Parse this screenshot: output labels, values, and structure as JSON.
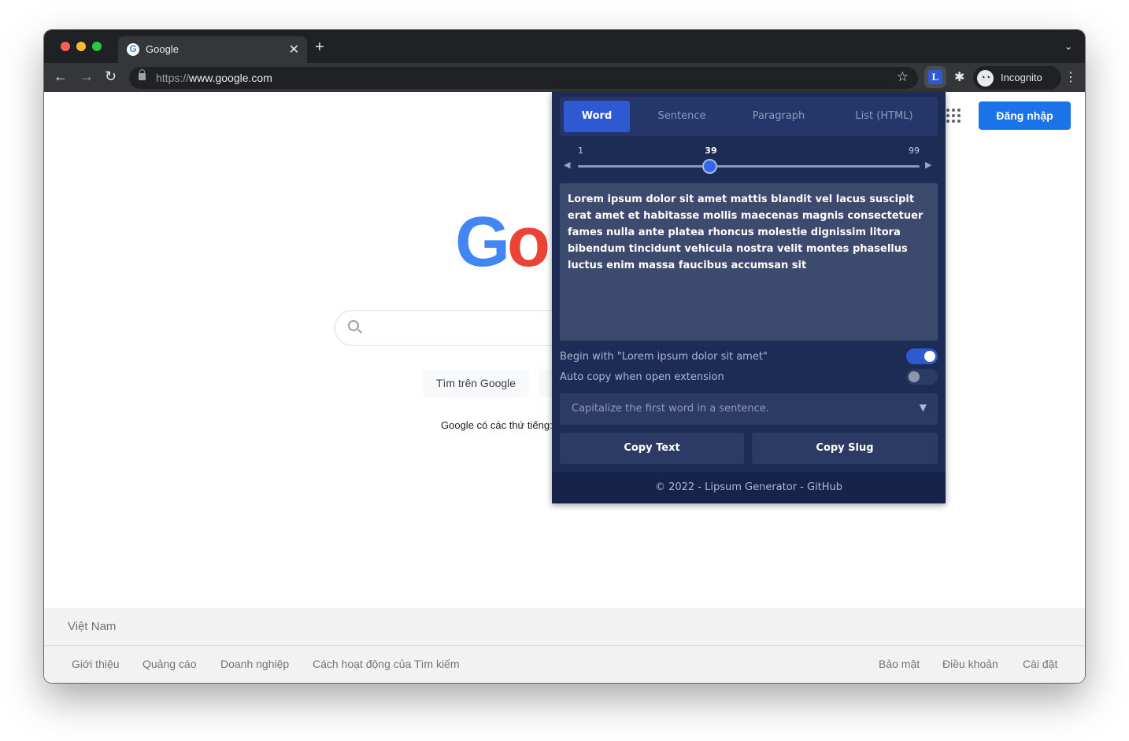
{
  "browser": {
    "tab_title": "Google",
    "tab_favicon_letter": "G",
    "tab_close": "✕",
    "new_tab": "+",
    "tab_search": "⌄",
    "nav": {
      "back": "←",
      "forward": "→",
      "reload": "↻"
    },
    "url_scheme": "https://",
    "url_host": "www.google.com",
    "star": "☆",
    "extension_letter": "L",
    "puzzle": "✱",
    "incognito_label": "Incognito",
    "incognito_glyph": "◔◔",
    "menu": "⋮"
  },
  "google": {
    "signin_label": "Đăng nhập",
    "logo_g": "G",
    "logo_o": "o",
    "search_button": "Tìm trên Google",
    "lucky_button": "",
    "languages_text": "Google có các thứ tiếng:",
    "country": "Việt Nam",
    "footer_left": [
      "Giới thiệu",
      "Quảng cáo",
      "Doanh nghiệp",
      "Cách hoạt động của Tìm kiếm"
    ],
    "footer_right": [
      "Bảo mật",
      "Điều khoản",
      "Cài đặt"
    ]
  },
  "popup": {
    "modes": [
      "Word",
      "Sentence",
      "Paragraph",
      "List (HTML)"
    ],
    "active_mode": "Word",
    "slider": {
      "min": "1",
      "value": "39",
      "max": "99",
      "arrow_left": "◀",
      "arrow_right": "▶",
      "fraction": 0.3878
    },
    "output_text": "Lorem ipsum dolor sit amet mattis blandit vel lacus suscipit erat amet et habitasse mollis maecenas magnis consectetuer fames nulla ante platea rhoncus molestie dignissim litora bibendum tincidunt vehicula nostra velit montes phasellus luctus enim massa faucibus accumsan sit",
    "option_begin_label": "Begin with \"Lorem ipsum dolor sit amet\"",
    "option_begin_on": true,
    "option_autocopy_label": "Auto copy when open extension",
    "option_autocopy_on": false,
    "capitalize_select": "Capitalize the first word in a sentence.",
    "select_caret": "▼",
    "copy_text": "Copy Text",
    "copy_slug": "Copy Slug",
    "footer": "© 2022 - Lipsum Generator - GitHub"
  },
  "colors": {
    "accent": "#2f58d3",
    "popup_bg": "#1c2c55",
    "google_blue": "#1a73e8"
  }
}
